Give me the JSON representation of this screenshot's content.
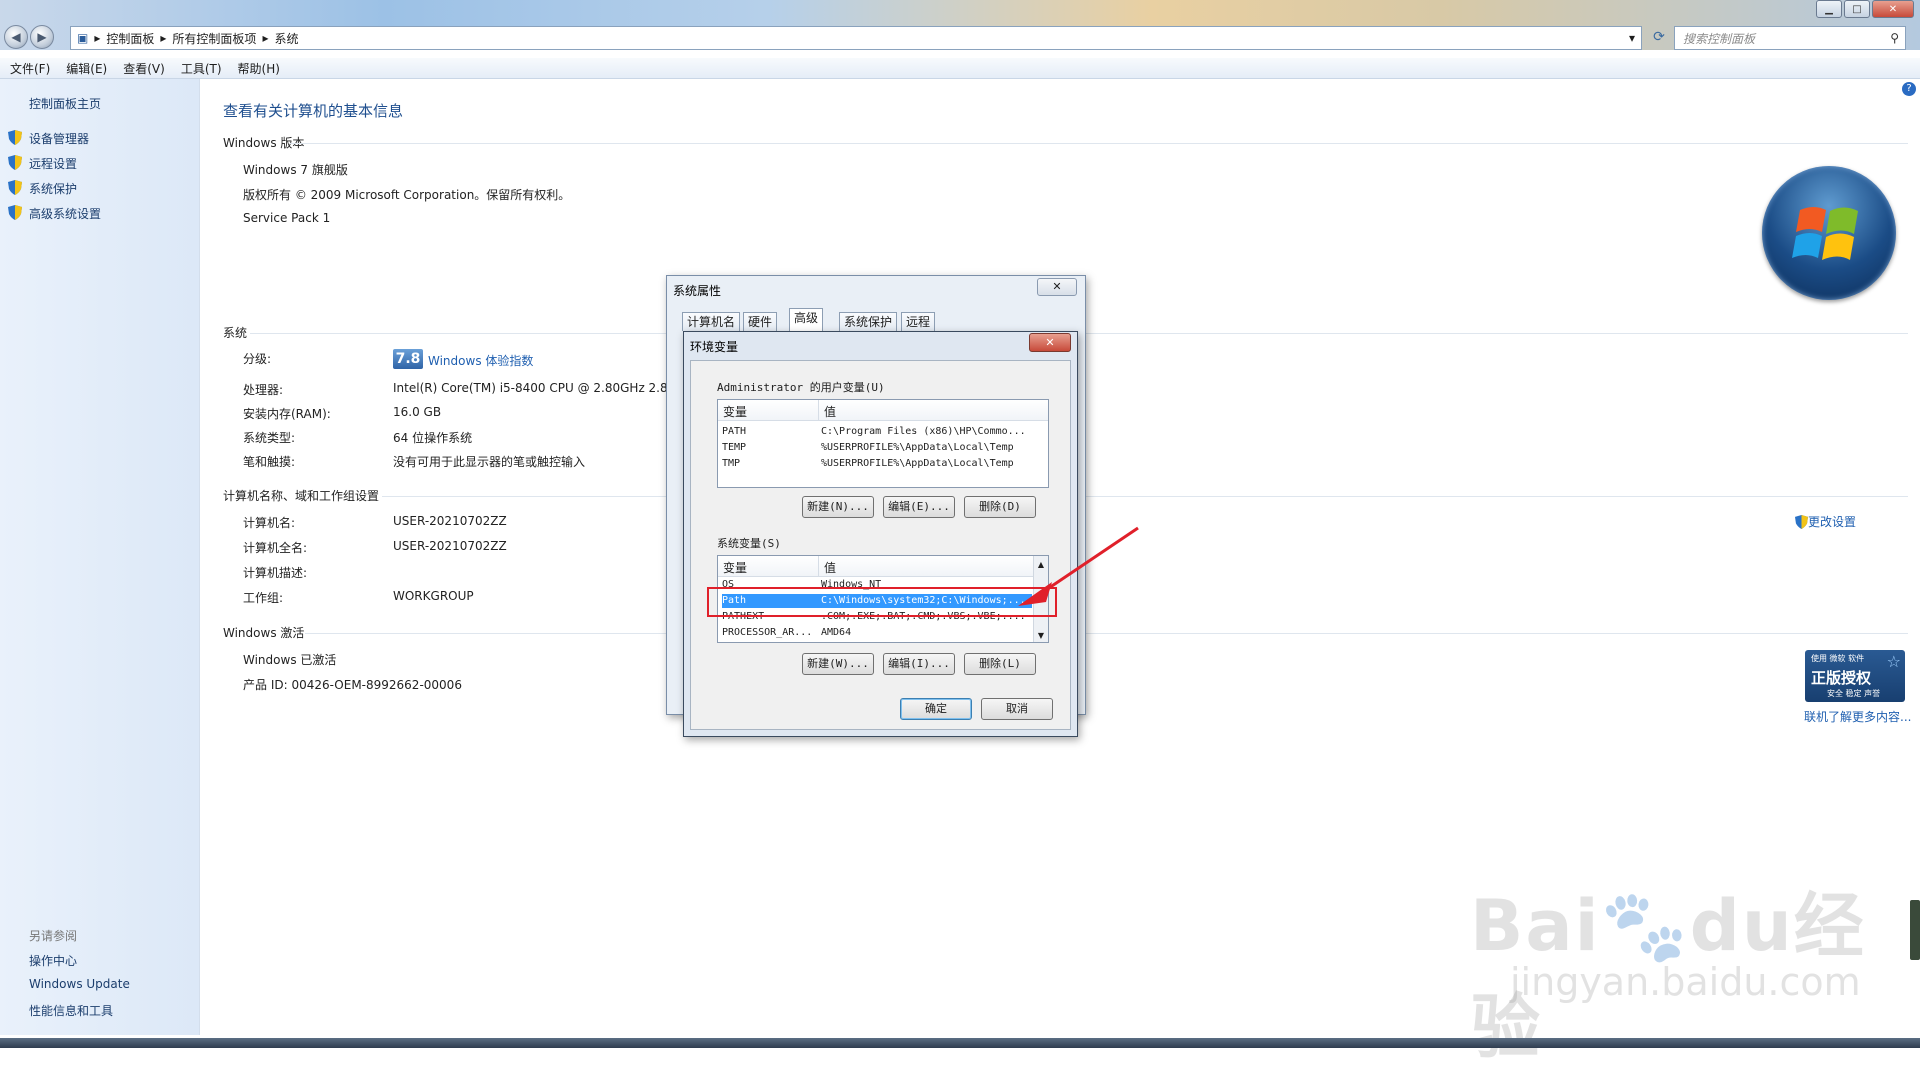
{
  "breadcrumb": [
    "控制面板",
    "所有控制面板项",
    "系统"
  ],
  "search": {
    "placeholder": "搜索控制面板"
  },
  "menu": [
    "文件(F)",
    "编辑(E)",
    "查看(V)",
    "工具(T)",
    "帮助(H)"
  ],
  "left_pane": {
    "home": "控制面板主页",
    "links": [
      "设备管理器",
      "远程设置",
      "系统保护",
      "高级系统设置"
    ],
    "see_also_title": "另请参阅",
    "see_also": [
      "操作中心",
      "Windows Update",
      "性能信息和工具"
    ]
  },
  "main": {
    "title": "查看有关计算机的基本信息",
    "edition_section": "Windows 版本",
    "edition": "Windows 7 旗舰版",
    "copyright": "版权所有 © 2009 Microsoft Corporation。保留所有权利。",
    "service_pack": "Service Pack 1",
    "system_section": "系统",
    "rating_label": "分级:",
    "rating_value": "7.8",
    "rating_link": "Windows 体验指数",
    "processor_label": "处理器:",
    "processor_value": "Intel(R) Core(TM) i5-8400 CPU @ 2.80GHz   2.8",
    "ram_label": "安装内存(RAM):",
    "ram_value": "16.0 GB",
    "systype_label": "系统类型:",
    "systype_value": "64 位操作系统",
    "pen_label": "笔和触摸:",
    "pen_value": "没有可用于此显示器的笔或触控输入",
    "computer_section": "计算机名称、域和工作组设置",
    "cname_label": "计算机名:",
    "cname_value": "USER-20210702ZZ",
    "fullname_label": "计算机全名:",
    "fullname_value": "USER-20210702ZZ",
    "desc_label": "计算机描述:",
    "workgroup_label": "工作组:",
    "workgroup_value": "WORKGROUP",
    "change_settings": "更改设置",
    "activation_section": "Windows 激活",
    "activated": "Windows 已激活",
    "product_id": "产品 ID: 00426-OEM-8992662-00006",
    "genuine_top": "使用 微软 软件",
    "genuine_main": "正版授权",
    "genuine_sub": "安全 稳定 声誉",
    "learn_more": "联机了解更多内容..."
  },
  "sysprops": {
    "title": "系统属性",
    "tabs": [
      "计算机名",
      "硬件",
      "高级",
      "系统保护",
      "远程"
    ]
  },
  "envvars": {
    "title": "环境变量",
    "user_group": "Administrator 的用户变量(U)",
    "col_var": "变量",
    "col_val": "值",
    "user_rows": [
      {
        "name": "PATH",
        "value": "C:\\Program Files (x86)\\HP\\Commo..."
      },
      {
        "name": "TEMP",
        "value": "%USERPROFILE%\\AppData\\Local\\Temp"
      },
      {
        "name": "TMP",
        "value": "%USERPROFILE%\\AppData\\Local\\Temp"
      }
    ],
    "user_buttons": [
      "新建(N)...",
      "编辑(E)...",
      "删除(D)"
    ],
    "sys_group": "系统变量(S)",
    "sys_rows": [
      {
        "name": "OS",
        "value": "Windows_NT"
      },
      {
        "name": "Path",
        "value": "C:\\Windows\\system32;C:\\Windows;..."
      },
      {
        "name": "PATHEXT",
        "value": ".COM;.EXE;.BAT;.CMD;.VBS;.VBE;...."
      },
      {
        "name": "PROCESSOR_AR...",
        "value": "AMD64"
      }
    ],
    "sys_buttons": [
      "新建(W)...",
      "编辑(I)...",
      "删除(L)"
    ],
    "ok": "确定",
    "cancel": "取消"
  },
  "watermark": {
    "brand": "Bai",
    "brand2": "du",
    "brand3": "经验",
    "url": "jingyan.baidu.com"
  },
  "colors": {
    "highlight": "#3399ff",
    "link": "#1f5fb0",
    "annotation": "#e0202a"
  }
}
